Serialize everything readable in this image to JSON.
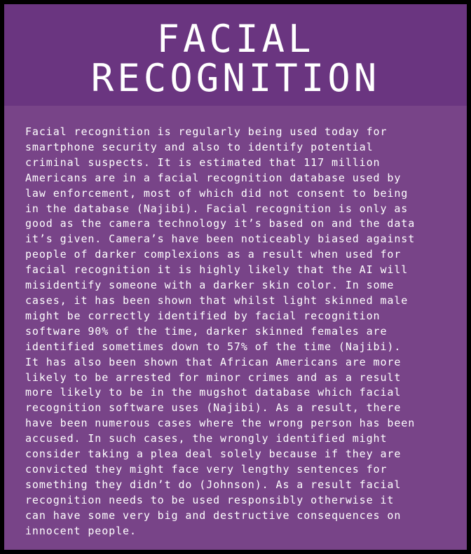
{
  "title": {
    "line1": "FACIAL",
    "line2": "RECOGNITION"
  },
  "body": {
    "lines": [
      "Facial recognition is regularly being used today for",
      "smartphone security and also to identify potential",
      "criminal suspects. It is estimated that 117 million",
      "Americans are in a facial recognition database used by",
      "law enforcement, most of which did not consent to being",
      "in the database (Najibi). Facial recognition is only as",
      "good as the camera technology it’s based on and the data",
      "it’s given. Camera’s have been noticeably biased against",
      "people of darker complexions as a result when used for",
      "facial recognition it is highly likely that the AI will",
      "misidentify someone with a darker skin color. In some",
      "cases, it has been shown that whilst light skinned male",
      "might be correctly identified by facial recognition",
      "software 90% of the time, darker skinned females are",
      "identified sometimes down to 57% of the time (Najibi).",
      "It has also been shown that African Americans are more",
      "likely to be arrested for minor crimes and as a result",
      "more likely to be in the mugshot database which facial",
      "recognition software uses (Najibi). As a result, there",
      "have been numerous cases where the wrong person has been",
      "accused. In such cases, the wrongly identified might",
      "consider taking a plea deal solely because if they are",
      "convicted they might face very lengthy sentences for",
      "something they didn’t do (Johnson). As a result facial",
      "recognition needs to be used responsibly otherwise it",
      "can have some very big and destructive consequences on",
      "innocent people."
    ]
  }
}
